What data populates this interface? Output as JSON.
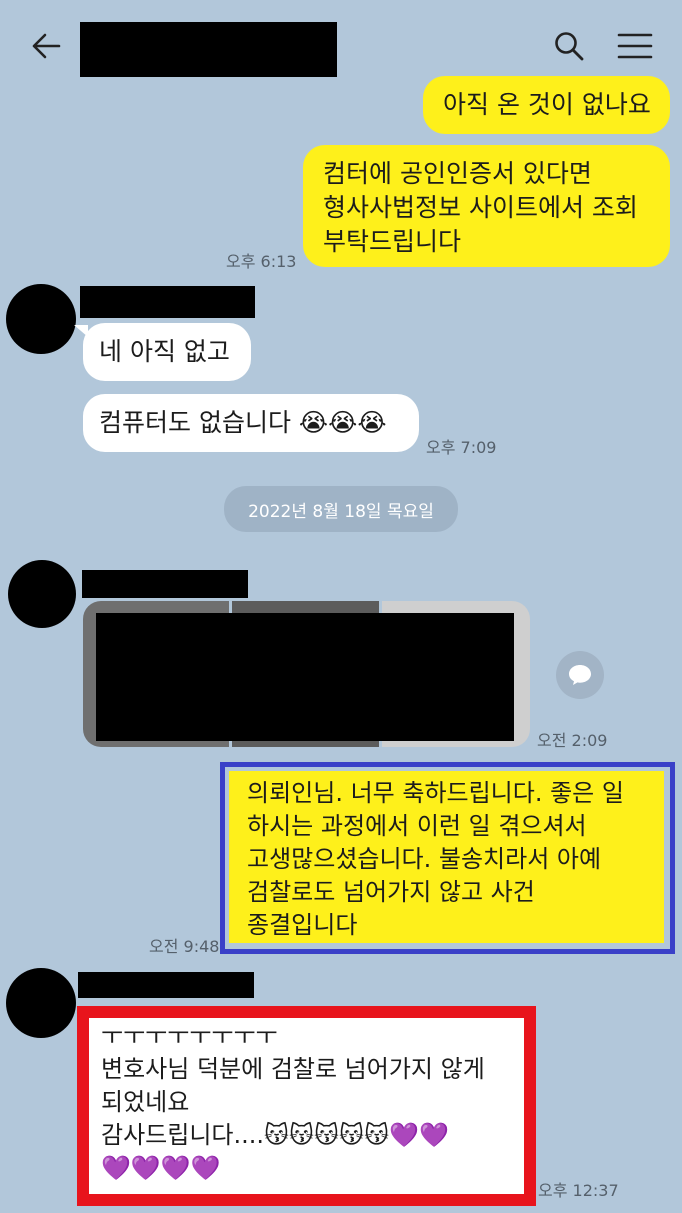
{
  "header": {
    "back_icon": "arrow-left-icon",
    "search_icon": "search-icon",
    "menu_icon": "hamburger-menu-icon"
  },
  "messages": [
    {
      "from": "me",
      "text": "아직 온 것이 없나요"
    },
    {
      "from": "me",
      "text": "컴터에 공인인증서 있다면\n형사사법정보 사이트에서 조회\n부탁드립니다",
      "time": "오후 6:13"
    },
    {
      "from": "other",
      "text": "네 아직 없고"
    },
    {
      "from": "other",
      "text": "컴퓨터도 없습니다 😭😭😭",
      "time": "오후 7:09"
    },
    {
      "from": "other",
      "type": "photos",
      "time": "오전 2:09"
    },
    {
      "from": "me",
      "text": "의뢰인님. 너무 축하드립니다. 좋은 일\n하시는 과정에서 이런 일 겪으셔서\n고생많으셨습니다. 불송치라서 아예\n검찰로도 넘어가지 않고 사건\n종결입니다",
      "time": "오전 9:48"
    },
    {
      "from": "other",
      "text": "ㅜㅜㅜㅜㅜㅜㅜㅜ\n변호사님 덕분에 검찰로 넘어가지 않게\n되었네요\n감사드립니다....😽😽😽😽😽💜💜\n💜💜💜💜",
      "time": "오후 12:37"
    }
  ],
  "date_divider": "2022년 8월 18일 목요일",
  "colors": {
    "background": "#b2c7da",
    "my_bubble": "#fef01b",
    "other_bubble": "#ffffff",
    "highlight_blue": "#3a40c8",
    "highlight_red": "#e8141c"
  }
}
